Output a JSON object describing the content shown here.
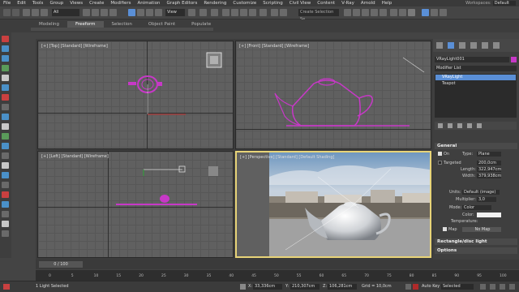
{
  "menu": {
    "items": [
      "File",
      "Edit",
      "Tools",
      "Group",
      "Views",
      "Create",
      "Modifiers",
      "Animation",
      "Graph Editors",
      "Rendering",
      "Customize",
      "Scripting",
      "Civil View",
      "Content",
      "V-Ray",
      "Arnold",
      "Help"
    ],
    "workspace_label": "Workspaces:",
    "workspace_value": "Default"
  },
  "toolbar": {
    "filter_value": "All",
    "view_value": "View",
    "selection_set_placeholder": "Create Selection Se"
  },
  "ribbon": {
    "tabs": [
      "Modeling",
      "Freeform",
      "Selection",
      "Object Paint",
      "Populate"
    ],
    "active_tab": "Freeform"
  },
  "viewports": {
    "top_label": "[+] [Top] [Standard] [Wireframe]",
    "front_label": "[+] [Front] [Standard] [Wireframe]",
    "left_label": "[+] [Left] [Standard] [Wireframe]",
    "persp_label": "[+] [Perspective] [Standard] [Default Shading]"
  },
  "command_panel": {
    "object_name": "VRayLight001",
    "modifier_list_label": "Modifier List",
    "stack": [
      "VRayLight",
      "Teapot"
    ],
    "general_rollout": "General",
    "on_label": "On",
    "type_label": "Type:",
    "type_value": "Plane",
    "targeted_label": "Targeted",
    "targeted_value": "200,0cm",
    "length_label": "Length:",
    "length_value": "322,947cm",
    "width_label": "Width:",
    "width_value": "379,938cm",
    "units_label": "Units:",
    "units_value": "Default (image)",
    "multiplier_label": "Multiplier:",
    "multiplier_value": "3,0",
    "mode_label": "Mode:",
    "mode_value": "Color",
    "color_label": "Color:",
    "temperature_label": "Temperature:",
    "map_label": "Map",
    "map_button": "No Map",
    "rect_rollout": "Rectangle/disc light",
    "options_rollout": "Options"
  },
  "timeline": {
    "frame_display": "0 / 100",
    "ticks": [
      "0",
      "5",
      "10",
      "15",
      "20",
      "25",
      "30",
      "35",
      "40",
      "45",
      "50",
      "55",
      "60",
      "65",
      "70",
      "75",
      "80",
      "85",
      "90",
      "95",
      "100"
    ]
  },
  "status": {
    "selection_text": "1 Light Selected",
    "x_label": "X:",
    "x_value": "33,336cm",
    "y_label": "Y:",
    "y_value": "210,307cm",
    "z_label": "Z:",
    "z_value": "106,281cm",
    "grid_text": "Grid = 10,0cm",
    "autokey_label": "Auto Key",
    "selected_value": "Selected"
  },
  "colors": {
    "selection_magenta": "#c738c7",
    "active_viewport_border": "#e8d478",
    "accent_blue": "#5a8fd6",
    "autokey_red": "#b02a2a"
  }
}
